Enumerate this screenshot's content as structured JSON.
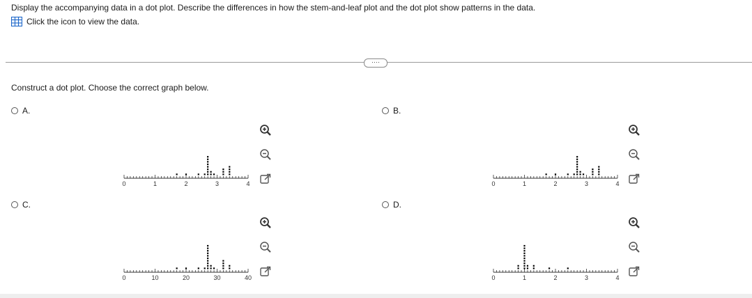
{
  "question": {
    "prompt": "Display the accompanying data in a dot plot. Describe the differences in how the stem-and-leaf plot and the dot plot show patterns in the data.",
    "data_link_label": "Click the icon to view the data."
  },
  "more_button_label": "····",
  "instruction": "Construct a dot plot. Choose the correct graph below.",
  "options": [
    {
      "label": "A.",
      "selected": false
    },
    {
      "label": "B.",
      "selected": false
    },
    {
      "label": "C.",
      "selected": false
    },
    {
      "label": "D.",
      "selected": false
    }
  ],
  "colors": {
    "accent": "#1a64c8",
    "axis": "#333333",
    "dot": "#000000"
  },
  "chart_data": [
    {
      "type": "scatter",
      "option": "A",
      "xlim": [
        0,
        4
      ],
      "tick_labels": [
        "0",
        "1",
        "2",
        "3",
        "4"
      ],
      "points": [
        [
          1.7,
          1
        ],
        [
          2.0,
          1
        ],
        [
          2.4,
          1
        ],
        [
          2.6,
          1
        ],
        [
          2.7,
          1
        ],
        [
          2.7,
          2
        ],
        [
          2.7,
          3
        ],
        [
          2.7,
          4
        ],
        [
          2.7,
          5
        ],
        [
          2.7,
          6
        ],
        [
          2.7,
          7
        ],
        [
          2.7,
          8
        ],
        [
          2.8,
          1
        ],
        [
          2.8,
          2
        ],
        [
          2.9,
          1
        ],
        [
          3.2,
          1
        ],
        [
          3.2,
          2
        ],
        [
          3.2,
          3
        ],
        [
          3.4,
          1
        ],
        [
          3.4,
          2
        ],
        [
          3.4,
          3
        ],
        [
          3.4,
          4
        ]
      ]
    },
    {
      "type": "scatter",
      "option": "B",
      "xlim": [
        0,
        4
      ],
      "tick_labels": [
        "0",
        "1",
        "2",
        "3",
        "4"
      ],
      "points": [
        [
          1.7,
          1
        ],
        [
          2.0,
          1
        ],
        [
          2.4,
          1
        ],
        [
          2.6,
          1
        ],
        [
          2.7,
          1
        ],
        [
          2.7,
          2
        ],
        [
          2.7,
          3
        ],
        [
          2.7,
          4
        ],
        [
          2.7,
          5
        ],
        [
          2.7,
          6
        ],
        [
          2.7,
          7
        ],
        [
          2.7,
          8
        ],
        [
          2.8,
          1
        ],
        [
          2.8,
          2
        ],
        [
          2.9,
          1
        ],
        [
          3.2,
          1
        ],
        [
          3.2,
          2
        ],
        [
          3.2,
          3
        ],
        [
          3.4,
          1
        ],
        [
          3.4,
          2
        ],
        [
          3.4,
          3
        ],
        [
          3.4,
          4
        ]
      ]
    },
    {
      "type": "scatter",
      "option": "C",
      "xlim": [
        0,
        40
      ],
      "tick_labels": [
        "0",
        "10",
        "20",
        "30",
        "40"
      ],
      "points": [
        [
          17,
          1
        ],
        [
          20,
          1
        ],
        [
          24,
          1
        ],
        [
          26,
          1
        ],
        [
          27,
          1
        ],
        [
          27,
          2
        ],
        [
          27,
          3
        ],
        [
          27,
          4
        ],
        [
          27,
          5
        ],
        [
          27,
          6
        ],
        [
          27,
          7
        ],
        [
          27,
          8
        ],
        [
          27,
          9
        ],
        [
          27,
          10
        ],
        [
          28,
          1
        ],
        [
          28,
          2
        ],
        [
          29,
          1
        ],
        [
          32,
          1
        ],
        [
          32,
          2
        ],
        [
          32,
          3
        ],
        [
          32,
          4
        ],
        [
          34,
          1
        ],
        [
          34,
          2
        ]
      ]
    },
    {
      "type": "scatter",
      "option": "D",
      "xlim": [
        0,
        4
      ],
      "tick_labels": [
        "0",
        "1",
        "2",
        "3",
        "4"
      ],
      "points": [
        [
          0.8,
          1
        ],
        [
          0.8,
          2
        ],
        [
          1.0,
          1
        ],
        [
          1.0,
          2
        ],
        [
          1.0,
          3
        ],
        [
          1.0,
          4
        ],
        [
          1.0,
          5
        ],
        [
          1.0,
          6
        ],
        [
          1.0,
          7
        ],
        [
          1.0,
          8
        ],
        [
          1.0,
          9
        ],
        [
          1.0,
          10
        ],
        [
          1.1,
          1
        ],
        [
          1.1,
          2
        ],
        [
          1.3,
          1
        ],
        [
          1.3,
          2
        ],
        [
          1.8,
          1
        ],
        [
          2.4,
          1
        ]
      ]
    }
  ]
}
